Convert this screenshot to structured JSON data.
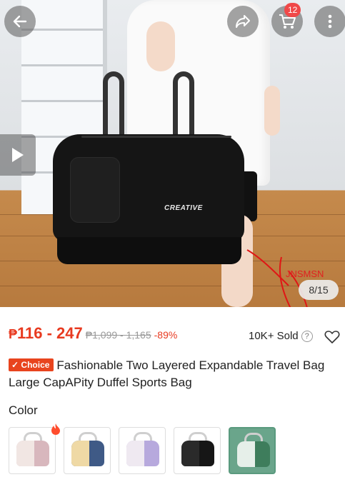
{
  "header": {
    "cart_count": "12",
    "icons": [
      "back-arrow-icon",
      "share-icon",
      "cart-icon",
      "more-vertical-icon",
      "play-icon"
    ]
  },
  "gallery": {
    "current": "8/15",
    "bag_logo_text": "CREATIVE",
    "watermark": "JNSMSN"
  },
  "pricing": {
    "currency": "₱",
    "range": "116 - 247",
    "original": "₱1,099 - 1,165",
    "discount": "-89%",
    "sold": "10K+ Sold",
    "help": "?"
  },
  "product": {
    "badge": "Choice",
    "title": "Fashionable Two Layered Expandable Travel Bag Large CapAPity Duffel Sports Bag"
  },
  "color": {
    "label": "Color",
    "options": [
      {
        "name": "pink",
        "main": "#d8b7bd",
        "accent": "#f1e6e3"
      },
      {
        "name": "navy-yellow",
        "main": "#3f5a86",
        "accent": "#efd9a5"
      },
      {
        "name": "purple",
        "main": "#b7a9dd",
        "accent": "#efe9f1"
      },
      {
        "name": "black",
        "main": "#161616",
        "accent": "#2a2a2a"
      },
      {
        "name": "green",
        "main": "#3e7d5c",
        "accent": "#e6efe9"
      }
    ],
    "selected_index": 4
  },
  "colors": {
    "price_red": "#e83a20",
    "choice_orange": "#e8441e",
    "badge_red": "#f04848"
  }
}
